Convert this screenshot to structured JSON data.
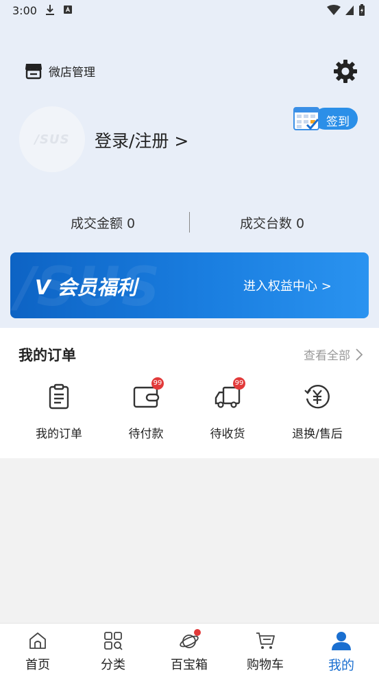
{
  "status_bar": {
    "time": "3:00"
  },
  "header": {
    "shop_label": "微店管理",
    "login_text": "登录/注册 >",
    "avatar_logo": "/SUS",
    "signin_label": "签到"
  },
  "stats": {
    "deal_amount": "成交金额 0",
    "deal_count": "成交台数 0"
  },
  "banner": {
    "watermark": "/SUS",
    "title": "V 会员福利",
    "link": "进入权益中心 >"
  },
  "orders": {
    "title": "我的订单",
    "view_all": "查看全部",
    "items": [
      {
        "label": "我的订单",
        "badge": ""
      },
      {
        "label": "待付款",
        "badge": "99"
      },
      {
        "label": "待收货",
        "badge": "99"
      },
      {
        "label": "退换/售后",
        "badge": ""
      }
    ]
  },
  "nav": {
    "items": [
      {
        "label": "首页"
      },
      {
        "label": "分类"
      },
      {
        "label": "百宝箱"
      },
      {
        "label": "购物车"
      },
      {
        "label": "我的"
      }
    ]
  },
  "colors": {
    "header_bg": "#e8eef8",
    "accent": "#1a6fd0",
    "badge": "#e23a3a",
    "banner_start": "#0d63c4",
    "banner_end": "#2a93f0"
  }
}
